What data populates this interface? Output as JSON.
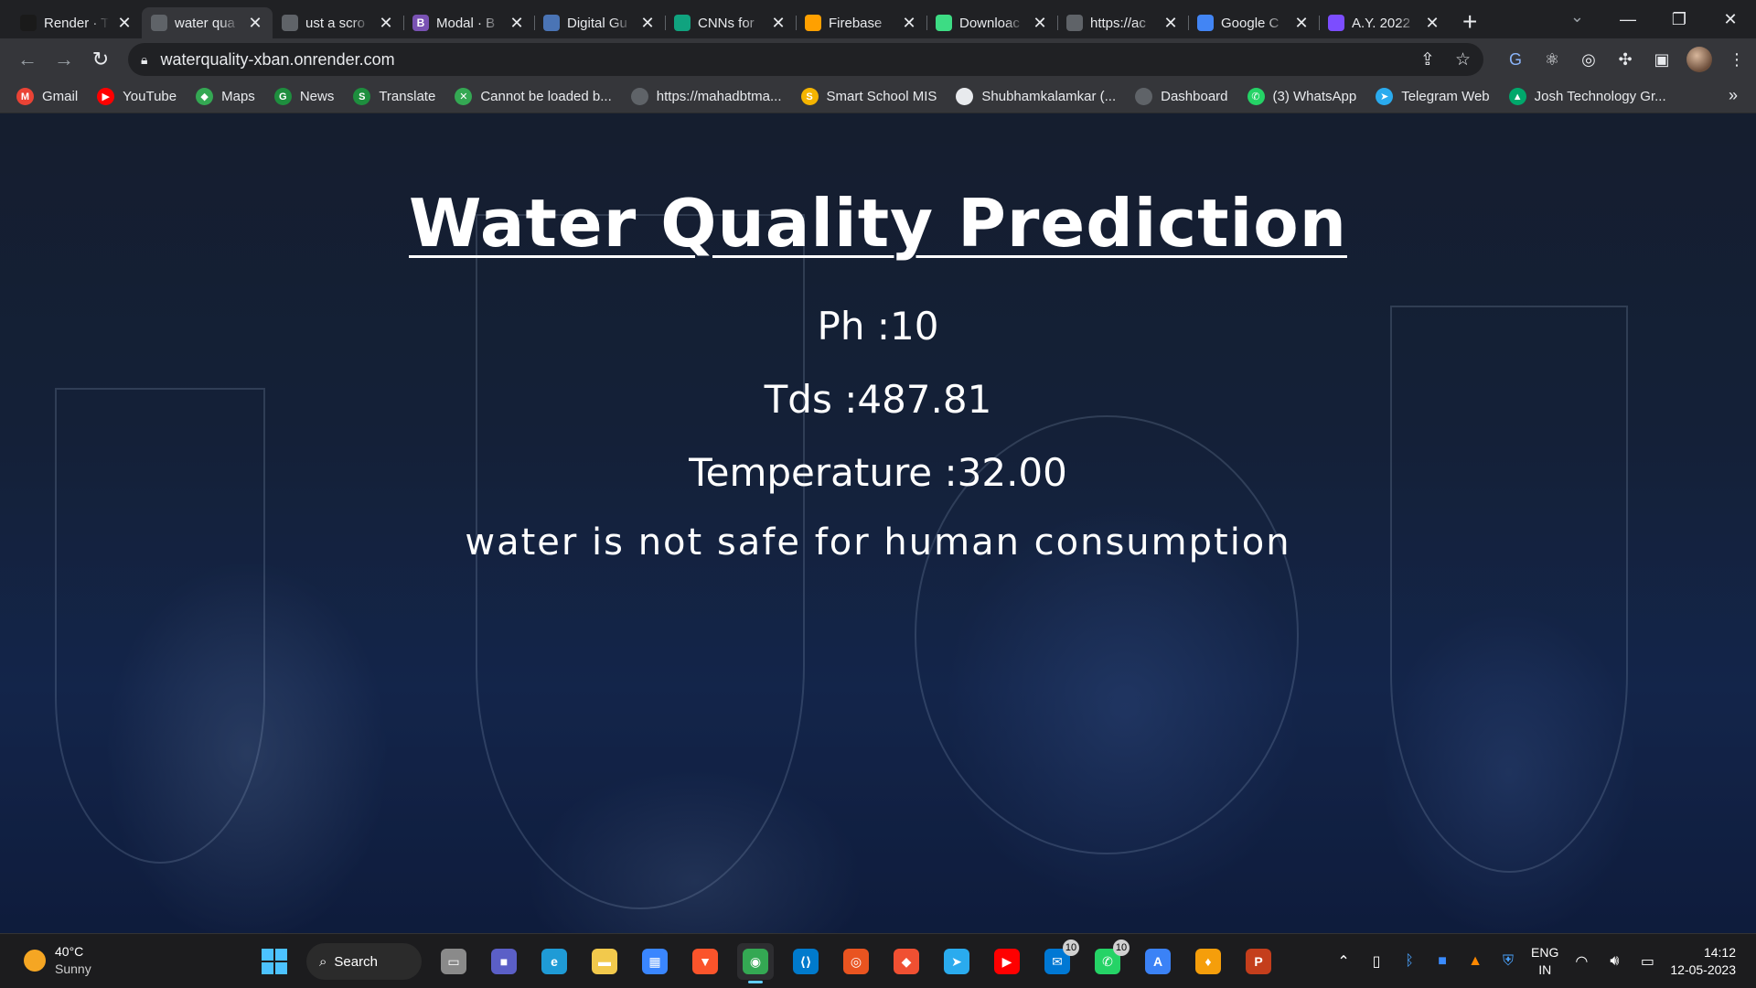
{
  "browser": {
    "tabs": [
      {
        "title": "Render · T",
        "favicon_color": "#1a1a1a",
        "favicon_glyph": "",
        "active": false
      },
      {
        "title": "water qua",
        "favicon_color": "#5f6368",
        "favicon_glyph": "",
        "active": true
      },
      {
        "title": "ust a scro",
        "favicon_color": "#5f6368",
        "favicon_glyph": "",
        "active": false
      },
      {
        "title": "Modal · B",
        "favicon_color": "#7952b3",
        "favicon_glyph": "B",
        "active": false
      },
      {
        "title": "Digital Gu",
        "favicon_color": "#4a74b5",
        "favicon_glyph": "",
        "active": false
      },
      {
        "title": "CNNs for",
        "favicon_color": "#10a37f",
        "favicon_glyph": "",
        "active": false
      },
      {
        "title": "Firebase",
        "favicon_color": "#ffa000",
        "favicon_glyph": "",
        "active": false
      },
      {
        "title": "Downloac",
        "favicon_color": "#3ddc84",
        "favicon_glyph": "",
        "active": false
      },
      {
        "title": "https://ac",
        "favicon_color": "#5f6368",
        "favicon_glyph": "",
        "active": false
      },
      {
        "title": "Google C",
        "favicon_color": "#4285f4",
        "favicon_glyph": "",
        "active": false
      },
      {
        "title": "A.Y. 2022",
        "favicon_color": "#7c4dff",
        "favicon_glyph": "",
        "active": false
      }
    ],
    "url": "waterquality-xban.onrender.com",
    "bookmarks": [
      {
        "label": "Gmail",
        "color": "#ea4335",
        "glyph": "M"
      },
      {
        "label": "YouTube",
        "color": "#ff0000",
        "glyph": "▶"
      },
      {
        "label": "Maps",
        "color": "#34a853",
        "glyph": "◆"
      },
      {
        "label": "News",
        "color": "#1e8e3e",
        "glyph": "G"
      },
      {
        "label": "Translate",
        "color": "#1e8e3e",
        "glyph": "S"
      },
      {
        "label": "Cannot be loaded b...",
        "color": "#34a853",
        "glyph": "✕"
      },
      {
        "label": "https://mahadbtma...",
        "color": "#5f6368",
        "glyph": ""
      },
      {
        "label": "Smart School MIS",
        "color": "#f4b400",
        "glyph": "S"
      },
      {
        "label": "Shubhamkalamkar (...",
        "color": "#e8eaed",
        "glyph": ""
      },
      {
        "label": "Dashboard",
        "color": "#5f6368",
        "glyph": ""
      },
      {
        "label": "(3) WhatsApp",
        "color": "#25d366",
        "glyph": "✆"
      },
      {
        "label": "Telegram Web",
        "color": "#2aabee",
        "glyph": "➤"
      },
      {
        "label": "Josh Technology Gr...",
        "color": "#00a86b",
        "glyph": "▲"
      }
    ]
  },
  "page": {
    "heading": "Water Quality Prediction",
    "ph": "Ph :10",
    "tds": "Tds :487.81",
    "temperature": "Temperature :32.00",
    "result": "water is not safe for human consumption"
  },
  "taskbar": {
    "weather_temp": "40°C",
    "weather_desc": "Sunny",
    "search_label": "Search",
    "apps": [
      {
        "name": "task-view",
        "color": "#8a8a8a",
        "glyph": "▭",
        "badge": ""
      },
      {
        "name": "teams",
        "color": "#5b5fc7",
        "glyph": "■",
        "badge": ""
      },
      {
        "name": "edge",
        "color": "#1f9bd6",
        "glyph": "e",
        "badge": ""
      },
      {
        "name": "file-explorer",
        "color": "#f2c94c",
        "glyph": "▬",
        "badge": ""
      },
      {
        "name": "store",
        "color": "#3a86ff",
        "glyph": "▦",
        "badge": ""
      },
      {
        "name": "brave",
        "color": "#fb542b",
        "glyph": "▼",
        "badge": ""
      },
      {
        "name": "chrome",
        "color": "#34a853",
        "glyph": "◉",
        "badge": "",
        "active": true
      },
      {
        "name": "vscode",
        "color": "#007acc",
        "glyph": "⟨⟩",
        "badge": ""
      },
      {
        "name": "ubuntu",
        "color": "#e95420",
        "glyph": "◎",
        "badge": ""
      },
      {
        "name": "git",
        "color": "#f05032",
        "glyph": "◆",
        "badge": ""
      },
      {
        "name": "telegram",
        "color": "#2aabee",
        "glyph": "➤",
        "badge": ""
      },
      {
        "name": "youtube",
        "color": "#ff0000",
        "glyph": "▶",
        "badge": ""
      },
      {
        "name": "mail",
        "color": "#0078d4",
        "glyph": "✉",
        "badge": "10"
      },
      {
        "name": "whatsapp",
        "color": "#25d366",
        "glyph": "✆",
        "badge": "10"
      },
      {
        "name": "app-a",
        "color": "#3b82f6",
        "glyph": "A",
        "badge": ""
      },
      {
        "name": "vpn",
        "color": "#f59e0b",
        "glyph": "♦",
        "badge": ""
      },
      {
        "name": "powerpoint",
        "color": "#c43e1c",
        "glyph": "P",
        "badge": ""
      }
    ],
    "lang_top": "ENG",
    "lang_bottom": "IN",
    "time": "14:12",
    "date": "12-05-2023"
  }
}
